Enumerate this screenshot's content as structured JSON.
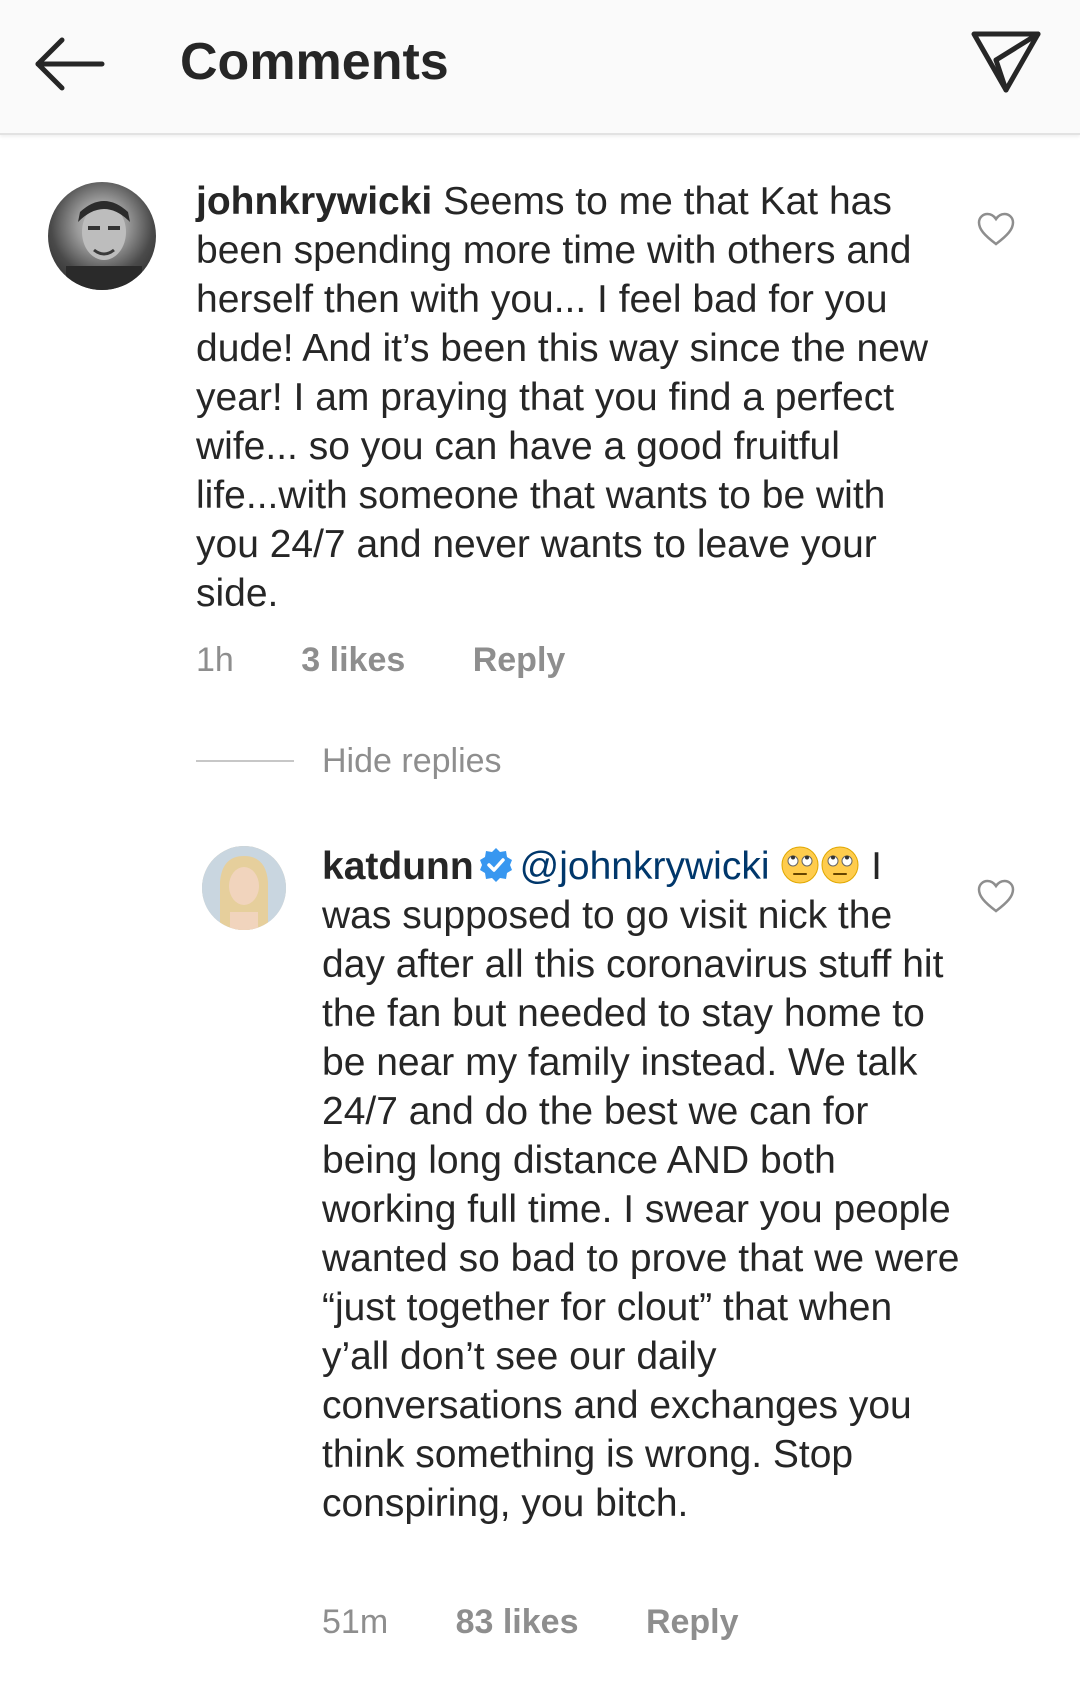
{
  "header": {
    "title": "Comments",
    "back_icon": "arrow-left-icon",
    "share_icon": "paper-plane-icon"
  },
  "comments": [
    {
      "username": "johnkrywicki",
      "text": "Seems to me that Kat has been spending more time with others and herself then with you... I feel bad for you dude! And it’s been this way since the new year! I am praying that you find a perfect wife... so you can have a good fruitful life...with someone that wants to be with you 24/7 and never wants to leave your side.",
      "time": "1h",
      "likes": "3 likes",
      "reply_label": "Reply",
      "like_icon": "heart-outline-icon"
    }
  ],
  "hide_replies_label": "Hide replies",
  "replies": [
    {
      "username": "katdunn",
      "verified": true,
      "mention": "@johnkrywicki",
      "emoji": "eye-roll-emoji",
      "text": "I was supposed to go visit nick the day after all this coronavirus stuff hit the fan but needed to stay home to be near my family instead. We talk 24/7 and do the best we can for being long distance AND both working full time. I swear you people wanted so bad to prove that we were “just together for clout” that when y’all don’t see our daily conversations and exchanges you think something is wrong. Stop conspiring, you bitch.",
      "time": "51m",
      "likes": "83 likes",
      "reply_label": "Reply",
      "like_icon": "heart-outline-icon"
    }
  ],
  "colors": {
    "text": "#262626",
    "secondary": "#8e8e8e",
    "mention": "#00376b",
    "verified": "#3897f0",
    "header_bg": "#fafafa"
  }
}
